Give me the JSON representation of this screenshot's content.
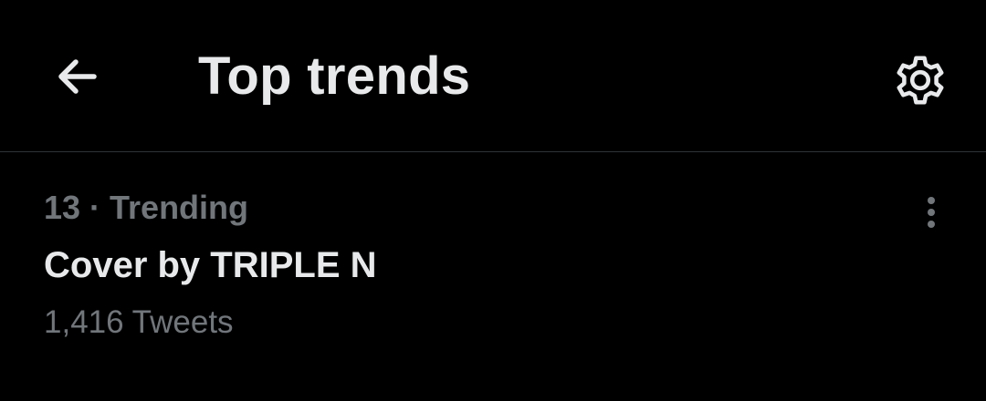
{
  "header": {
    "title": "Top trends",
    "back_icon": "arrow-left-icon",
    "settings_icon": "gear-icon"
  },
  "trends": [
    {
      "rank": "13",
      "separator": "·",
      "category": "Trending",
      "meta": "13 · Trending",
      "name": "Cover by TRIPLE N",
      "tweet_count": "1,416 Tweets",
      "more_icon": "more-vertical-icon"
    }
  ],
  "colors": {
    "background": "#000000",
    "primary_text": "#e7e9ea",
    "secondary_text": "#71767b",
    "divider": "#2f3336"
  }
}
